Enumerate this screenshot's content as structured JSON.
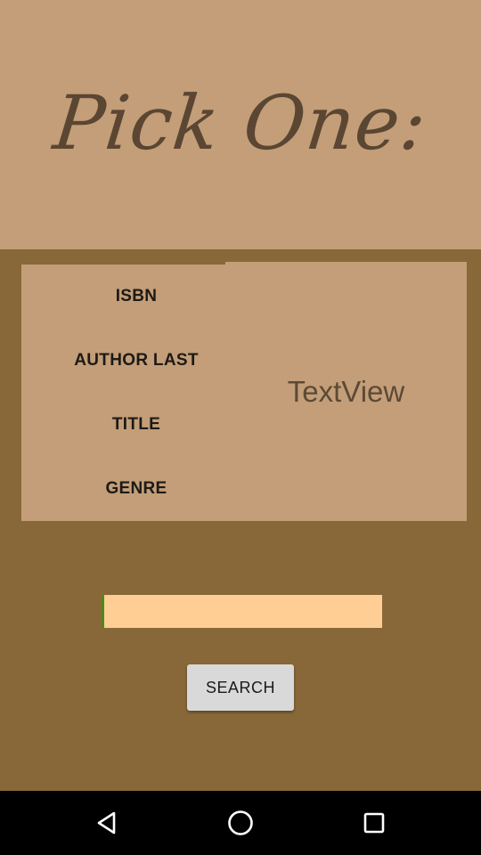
{
  "header": {
    "title": "Pick One:"
  },
  "options": [
    {
      "label": "ISBN"
    },
    {
      "label": "AUTHOR LAST"
    },
    {
      "label": "TITLE"
    },
    {
      "label": "GENRE"
    }
  ],
  "result": {
    "text": "TextView"
  },
  "search": {
    "value": "",
    "placeholder": "",
    "button_label": "SEARCH"
  },
  "navbar": {
    "back_icon": "back-triangle-icon",
    "home_icon": "home-circle-icon",
    "recent_icon": "recent-apps-square-icon"
  },
  "colors": {
    "header_bg": "#c39e78",
    "screen_bg": "#886838",
    "input_bg": "#ffce95",
    "cursor": "#4e8a1a"
  }
}
